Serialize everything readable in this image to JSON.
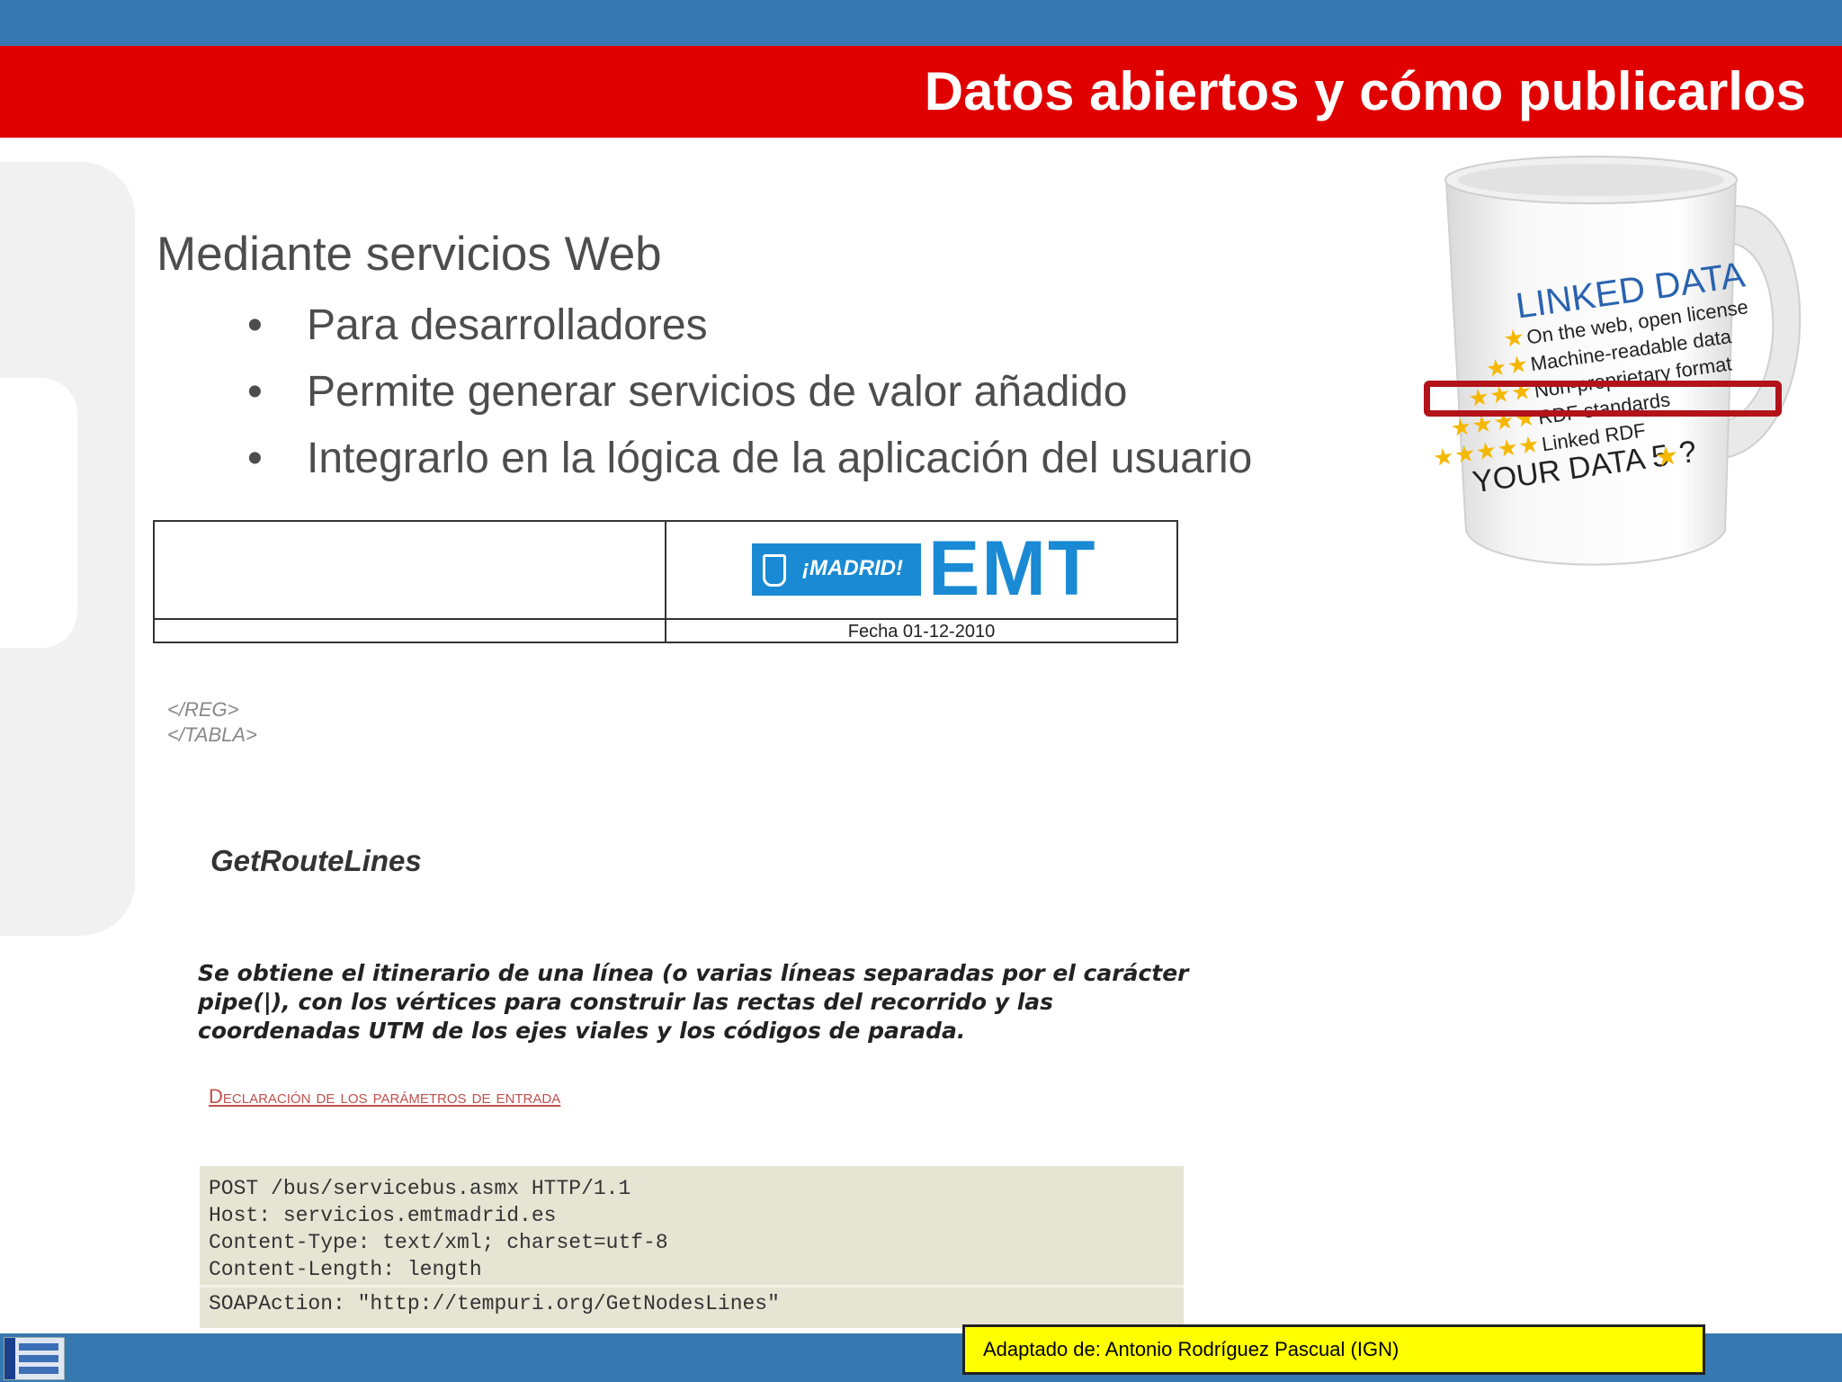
{
  "slide": {
    "title": "Datos abiertos y cómo publicarlos",
    "heading": "Mediante servicios Web",
    "bullets": [
      "Para desarrolladores",
      "Permite generar servicios de valor añadido",
      "Integrarlo en la lógica de la aplicación del usuario"
    ],
    "bullet_glyph": "•",
    "credit": "Adaptado de: Antonio Rodríguez Pascual (IGN)"
  },
  "document": {
    "logo_madrid": "¡MADRID!",
    "logo_emt": "EMT",
    "date": "Fecha 01-12-2010",
    "xml_tags": [
      "</REG>",
      "</TABLA>"
    ],
    "method": "GetRouteLines",
    "description": "Se obtiene el itinerario de una línea (o varias líneas separadas por el carácter pipe(|), con los vértices para construir las rectas del recorrido y las coordenadas UTM de los ejes viales y los códigos de parada.",
    "params_link": "Declaración de los parámetros de entrada",
    "code_lines": "POST /bus/servicebus.asmx HTTP/1.1\nHost: servicios.emtmadrid.es\nContent-Type: text/xml; charset=utf-8\nContent-Length: length",
    "soap_action": "SOAPAction: \"http://tempuri.org/GetNodesLines\""
  },
  "mug": {
    "title": "LINKED DATA",
    "lines": [
      "On the web, open license",
      "Machine-readable data",
      "Non-proprietary format",
      "RDF standards",
      "Linked RDF"
    ],
    "footer_text": "YOUR DATA 5",
    "footer_q": "?"
  },
  "colors": {
    "top_band": "#3579b0",
    "title_band": "#e00000",
    "credit_bg": "#ffff00",
    "highlight": "#b3121a",
    "emt_blue": "#1a8ad4"
  }
}
